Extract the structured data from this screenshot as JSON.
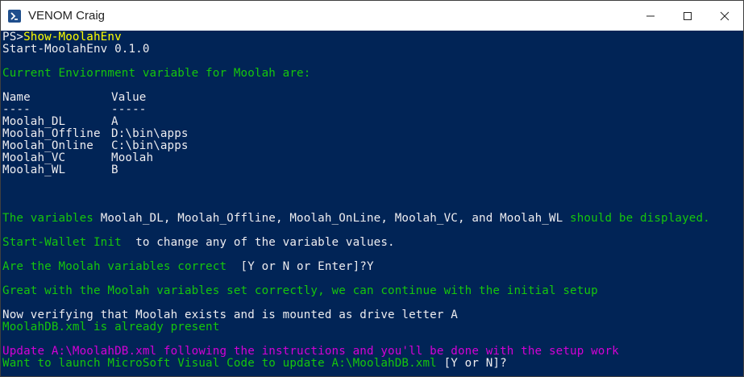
{
  "window": {
    "title": "VENOM Craig",
    "icon": "powershell-icon",
    "controls": [
      "minimize-icon",
      "maximize-icon",
      "close-icon"
    ]
  },
  "colors": {
    "background": "#012456",
    "default_text": "#eeedf0",
    "command": "#ffff00",
    "green": "#16c60c",
    "magenta": "#d600d6"
  },
  "console": {
    "prompt": "PS>",
    "command": "Show-MoolahEnv",
    "start_line": "Start-MoolahEnv 0.1.0",
    "header": "Current Enviornment variable for Moolah are:",
    "table": {
      "headers": [
        "Name",
        "Value"
      ],
      "underline": [
        "----",
        "-----"
      ],
      "rows": [
        {
          "name": "Moolah_DL",
          "value": "A"
        },
        {
          "name": "Moolah_Offline",
          "value": "D:\\bin\\apps"
        },
        {
          "name": "Moolah_Online",
          "value": "C:\\bin\\apps"
        },
        {
          "name": "Moolah_VC",
          "value": "Moolah"
        },
        {
          "name": "Moolah_WL",
          "value": "B"
        }
      ]
    },
    "variables_line": {
      "prefix": "The variables ",
      "list": "Moolah_DL, Moolah_Offline, Moolah_OnLine, Moolah_VC, and Moolah_WL",
      "suffix": " should be displayed."
    },
    "wallet_line": {
      "command": "Start-Wallet Init",
      "text": "  to change any of the variable values."
    },
    "confirm_line": {
      "question": "Are the Moolah variables correct",
      "options": "  [Y or N or Enter]?Y"
    },
    "great_line": "Great with the Moolah variables set correctly, we can continue with the initial setup",
    "verify_line": "Now verifying that Moolah exists and is mounted as drive letter A",
    "present_line": "MoolahDB.xml is already present",
    "update_line": "Update A:\\MoolahDB.xml following the instructions and you'll be done with the setup work",
    "launch_line": {
      "question": "Want to launch MicroSoft Visual Code to update A:\\MoolahDB.xml",
      "options": " [Y or N]?"
    }
  }
}
